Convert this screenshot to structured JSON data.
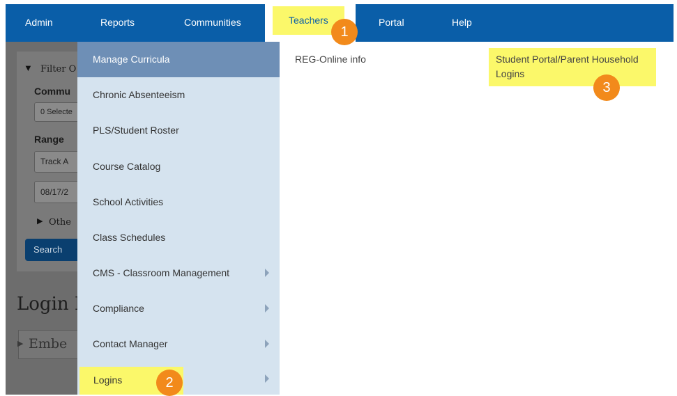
{
  "nav": {
    "admin": "Admin",
    "reports": "Reports",
    "communities": "Communities",
    "teachers": "Teachers",
    "portal": "Portal",
    "help": "Help"
  },
  "badges": {
    "one": "1",
    "two": "2",
    "three": "3"
  },
  "left": {
    "filter_label": "Filter O",
    "communities_label": "Commu",
    "communities_value": "0 Selecte",
    "range_label": "Range",
    "range_value": "Track A",
    "date_value": "08/17/2",
    "other_label": "Othe",
    "search_button": "Search",
    "page_title": "Login I",
    "embed_label": "Embe"
  },
  "menu": {
    "items": [
      {
        "label": "Manage Curricula",
        "submenu": false
      },
      {
        "label": "Chronic Absenteeism",
        "submenu": false
      },
      {
        "label": "PLS/Student Roster",
        "submenu": false
      },
      {
        "label": "Course Catalog",
        "submenu": false
      },
      {
        "label": "School Activities",
        "submenu": false
      },
      {
        "label": "Class Schedules",
        "submenu": false
      },
      {
        "label": "CMS - Classroom Management",
        "submenu": true
      },
      {
        "label": "Compliance",
        "submenu": true
      },
      {
        "label": "Contact Manager",
        "submenu": true
      },
      {
        "label": "Logins",
        "submenu": true
      }
    ]
  },
  "submenu": {
    "reg_online": "REG-Online info",
    "student_portal_line1": "Student Portal/Parent Household",
    "student_portal_line2": "Logins"
  },
  "colors": {
    "nav_blue": "#0a5ea8",
    "highlight_yellow": "#fbf86a",
    "badge_orange": "#f28a1b",
    "menu_bg": "#d5e3ef",
    "menu_active": "#6e8fb6"
  }
}
